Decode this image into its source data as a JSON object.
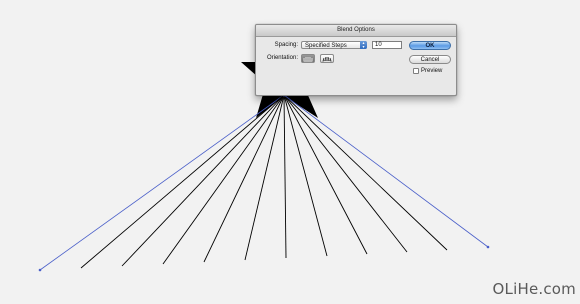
{
  "dialog": {
    "title": "Blend Options",
    "spacing_label": "Spacing:",
    "spacing_value": "Specified Steps",
    "steps_value": "10",
    "orientation_label": "Orientation:",
    "orientation_options": [
      "align-to-page-icon",
      "align-to-path-icon"
    ],
    "ok_label": "OK",
    "cancel_label": "Cancel",
    "preview_label": "Preview",
    "preview_checked": false
  },
  "artwork": {
    "star_color": "#000000",
    "blend_line_color": "#000000",
    "path_highlight_color": "#4a5fc9",
    "line_count": 12
  },
  "watermark": "OLiHe.com"
}
